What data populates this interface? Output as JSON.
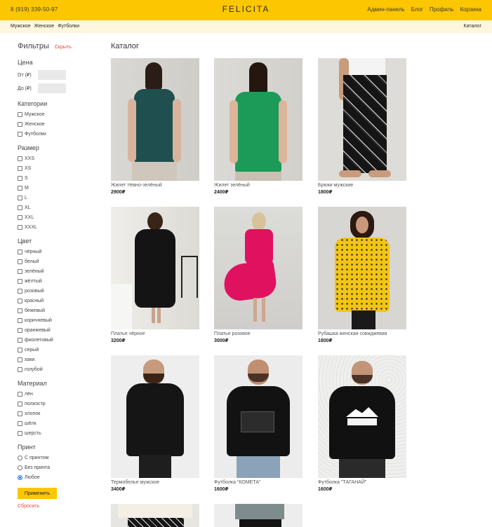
{
  "header": {
    "phone": "8 (919) 339-50-97",
    "logo": "FELICITA",
    "nav": [
      "Админ-панель",
      "Блог",
      "Профиль",
      "Корзина"
    ]
  },
  "subnav": {
    "categories": [
      "Мужское",
      "Женское",
      "Футболки"
    ],
    "cart": "Каталог"
  },
  "filters": {
    "title": "Фильтры",
    "hide": "Скрыть",
    "price": {
      "title": "Цена",
      "from": "От (₽)",
      "to": "До (₽)"
    },
    "categories": {
      "title": "Категории",
      "items": [
        "Мужское",
        "Женское",
        "Футболки"
      ]
    },
    "size": {
      "title": "Размер",
      "items": [
        "XXS",
        "XS",
        "S",
        "M",
        "L",
        "XL",
        "XXL",
        "XXXL"
      ]
    },
    "color": {
      "title": "Цвет",
      "items": [
        "чёрный",
        "белый",
        "зелёный",
        "жёлтый",
        "розовый",
        "красный",
        "бежевый",
        "коричневый",
        "оранжевый",
        "фиолетовый",
        "серый",
        "хаки",
        "голубой"
      ]
    },
    "material": {
      "title": "Материал",
      "items": [
        "лён",
        "полиэстр",
        "хлопок",
        "шёлк",
        "шерсть"
      ]
    },
    "print": {
      "title": "Принт",
      "items": [
        "С принтом",
        "Без принта",
        "Любое"
      ],
      "selected": "Любое"
    },
    "apply": "Применить",
    "reset": "Сбросить"
  },
  "catalog": {
    "title": "Каталог",
    "products": [
      {
        "name": "Жилет тёмно-зелёный",
        "price": "2900₽",
        "image": "woman-back-dark-green-vest"
      },
      {
        "name": "Жилет зелёный",
        "price": "2400₽",
        "image": "woman-back-green-vest"
      },
      {
        "name": "Брюки мужские",
        "price": "1800₽",
        "image": "man-black-printed-trousers"
      },
      {
        "name": "Платье чёрное",
        "price": "3200₽",
        "image": "woman-black-dress"
      },
      {
        "name": "Платье розовое",
        "price": "3000₽",
        "image": "woman-pink-dress"
      },
      {
        "name": "Рубашка женская совиджевая",
        "price": "1800₽",
        "image": "woman-yellow-shirt"
      },
      {
        "name": "Термобелье мужское",
        "price": "3400₽",
        "image": "man-black-thermal"
      },
      {
        "name": "Футболка \"КОМЕТА\"",
        "price": "1600₽",
        "image": "man-black-tshirt-comet"
      },
      {
        "name": "Футболка \"ТАГАНАЙ\"",
        "price": "1600₽",
        "image": "man-black-tshirt-taganay"
      },
      {
        "name": "",
        "price": "",
        "image": "man-white-tshirt-partial"
      },
      {
        "name": "",
        "price": "",
        "image": "man-grey-tshirt-partial"
      }
    ]
  },
  "colors": {
    "accent": "#fcc600",
    "subbar": "#fff7dd",
    "danger": "#e3483a"
  }
}
